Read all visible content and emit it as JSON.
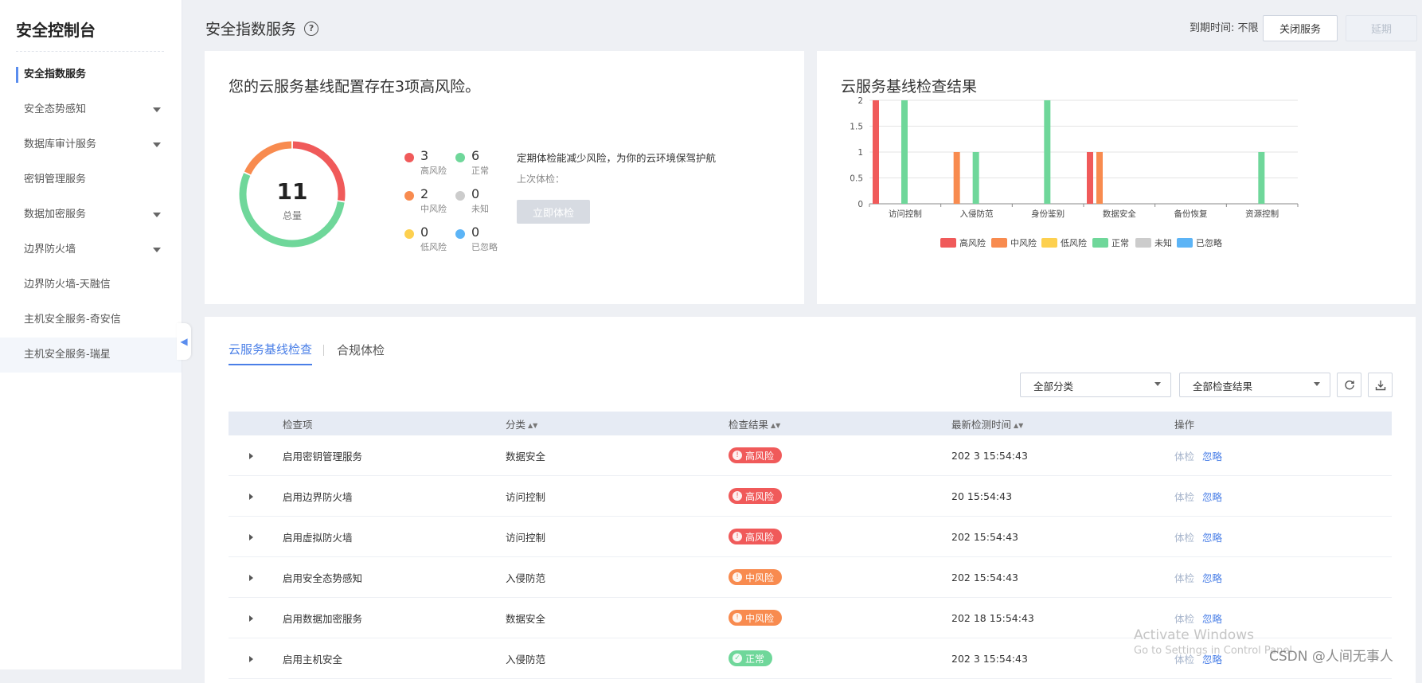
{
  "sidebar": {
    "title": "安全控制台",
    "items": [
      {
        "label": "安全指数服务",
        "active": true,
        "caret": false
      },
      {
        "label": "安全态势感知",
        "caret": true
      },
      {
        "label": "数据库审计服务",
        "caret": true
      },
      {
        "label": "密钥管理服务",
        "caret": false
      },
      {
        "label": "数据加密服务",
        "caret": true
      },
      {
        "label": "边界防火墙",
        "caret": true
      },
      {
        "label": "边界防火墙-天融信",
        "caret": false
      },
      {
        "label": "主机安全服务-奇安信",
        "caret": false
      },
      {
        "label": "主机安全服务-瑞星",
        "caret": false
      }
    ]
  },
  "header": {
    "title": "安全指数服务",
    "expire": "到期时间: 不限",
    "close_btn": "关闭服务",
    "renew_btn": "延期"
  },
  "summary": {
    "headline": "您的云服务基线配置存在3项高风险。",
    "total": "11",
    "total_label": "总量",
    "stats": [
      {
        "num": "3",
        "label": "高风险",
        "color": "#f05a5a"
      },
      {
        "num": "6",
        "label": "正常",
        "color": "#6fd79a"
      },
      {
        "num": "2",
        "label": "中风险",
        "color": "#f88b4f"
      },
      {
        "num": "0",
        "label": "未知",
        "color": "#cccccc"
      },
      {
        "num": "0",
        "label": "低风险",
        "color": "#fdd04f"
      },
      {
        "num": "0",
        "label": "已忽略",
        "color": "#5cb4f6"
      }
    ],
    "tip": "定期体检能减少风险，为你的云环境保驾护航",
    "last_check": "上次体检：",
    "check_btn": "立即体检"
  },
  "chart_data": {
    "type": "bar",
    "title": "云服务基线检查结果",
    "categories": [
      "访问控制",
      "入侵防范",
      "身份鉴别",
      "数据安全",
      "备份恢复",
      "资源控制"
    ],
    "ylim": [
      0,
      2
    ],
    "yticks": [
      "0",
      "0.5",
      "1",
      "1.5",
      "2"
    ],
    "legend_position": "bottom",
    "series": [
      {
        "name": "高风险",
        "color": "#f05a5a",
        "values": [
          2,
          0,
          0,
          1,
          0,
          0
        ]
      },
      {
        "name": "中风险",
        "color": "#f88b4f",
        "values": [
          0,
          1,
          0,
          1,
          0,
          0
        ]
      },
      {
        "name": "低风险",
        "color": "#fdd04f",
        "values": [
          0,
          0,
          0,
          0,
          0,
          0
        ]
      },
      {
        "name": "正常",
        "color": "#6fd79a",
        "values": [
          2,
          1,
          2,
          0,
          0,
          1
        ]
      },
      {
        "name": "未知",
        "color": "#cccccc",
        "values": [
          0,
          0,
          0,
          0,
          0,
          0
        ]
      },
      {
        "name": "已忽略",
        "color": "#5cb4f6",
        "values": [
          0,
          0,
          0,
          0,
          0,
          0
        ]
      }
    ]
  },
  "tabs": [
    {
      "label": "云服务基线检查"
    },
    {
      "label": "合规体检"
    }
  ],
  "filters": {
    "category": "全部分类",
    "result": "全部检查结果"
  },
  "table": {
    "columns": [
      "检查项",
      "分类",
      "检查结果",
      "最新检测时间",
      "操作"
    ],
    "rows": [
      {
        "item": "启用密钥管理服务",
        "category": "数据安全",
        "result": "高风险",
        "level": "high",
        "time": "202       3 15:54:43"
      },
      {
        "item": "启用边界防火墙",
        "category": "访问控制",
        "result": "高风险",
        "level": "high",
        "time": "20       15:54:43"
      },
      {
        "item": "启用虚拟防火墙",
        "category": "访问控制",
        "result": "高风险",
        "level": "high",
        "time": "202        15:54:43"
      },
      {
        "item": "启用安全态势感知",
        "category": "入侵防范",
        "result": "中风险",
        "level": "mid",
        "time": "202       15:54:43"
      },
      {
        "item": "启用数据加密服务",
        "category": "数据安全",
        "result": "中风险",
        "level": "mid",
        "time": "202     18 15:54:43"
      },
      {
        "item": "启用主机安全",
        "category": "入侵防范",
        "result": "正常",
        "level": "ok",
        "time": "202      3 15:54:43"
      }
    ],
    "op_detect": "体检",
    "op_ignore": "忽略"
  },
  "overlay": {
    "activate": "Activate Windows",
    "activate_sub": "Go to Settings in Control Panel",
    "csdn": "CSDN @人间无事人"
  }
}
